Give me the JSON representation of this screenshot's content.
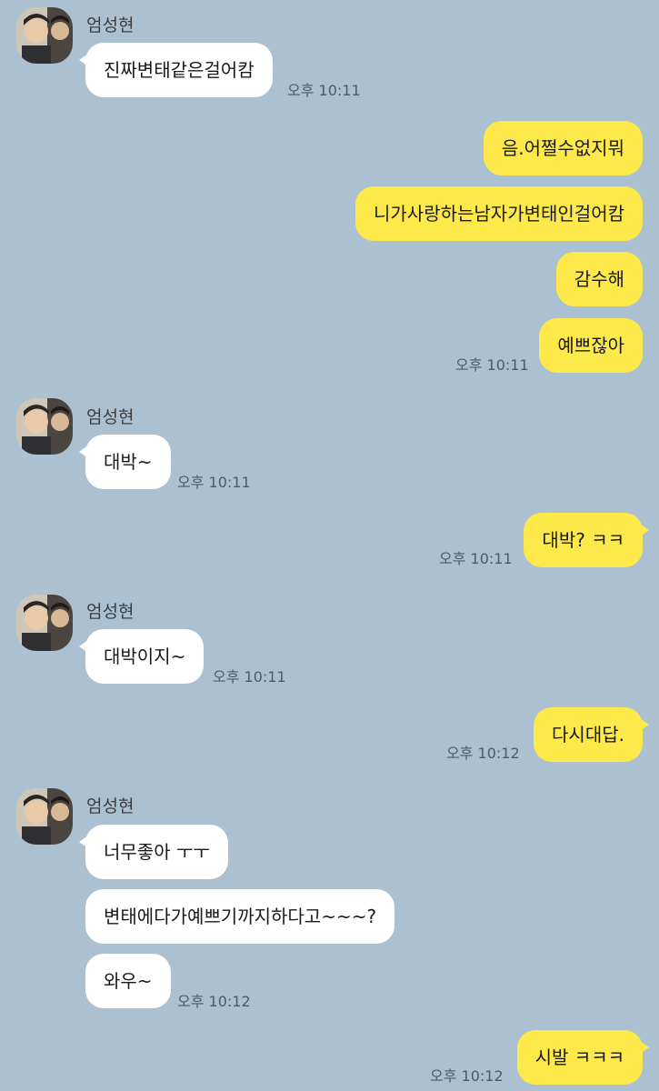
{
  "colors": {
    "background": "#abc1d1",
    "incoming_bubble": "#ffffff",
    "outgoing_bubble": "#fde94a"
  },
  "sender_name": "엄성현",
  "messages": {
    "m1": "진짜변태같은걸어캄",
    "m2": "음.어쩔수없지뭐",
    "m3": "니가사랑하는남자가변태인걸어캄",
    "m4": "감수해",
    "m5": "예쁘잖아",
    "m6": "대박~",
    "m7": "대박? ㅋㅋ",
    "m8": "대박이지~",
    "m9": "다시대답.",
    "m10": "너무좋아 ㅜㅜ",
    "m11": "변태에다가예쁘기까지하다고~~~?",
    "m12": "와우~",
    "m13": "시발 ㅋㅋㅋ"
  },
  "times": {
    "t1": "오후 10:11",
    "t2": "오후 10:11",
    "t3": "오후 10:11",
    "t4": "오후 10:11",
    "t5": "오후 10:11",
    "t6": "오후 10:12",
    "t7": "오후 10:12",
    "t8": "오후 10:12"
  }
}
